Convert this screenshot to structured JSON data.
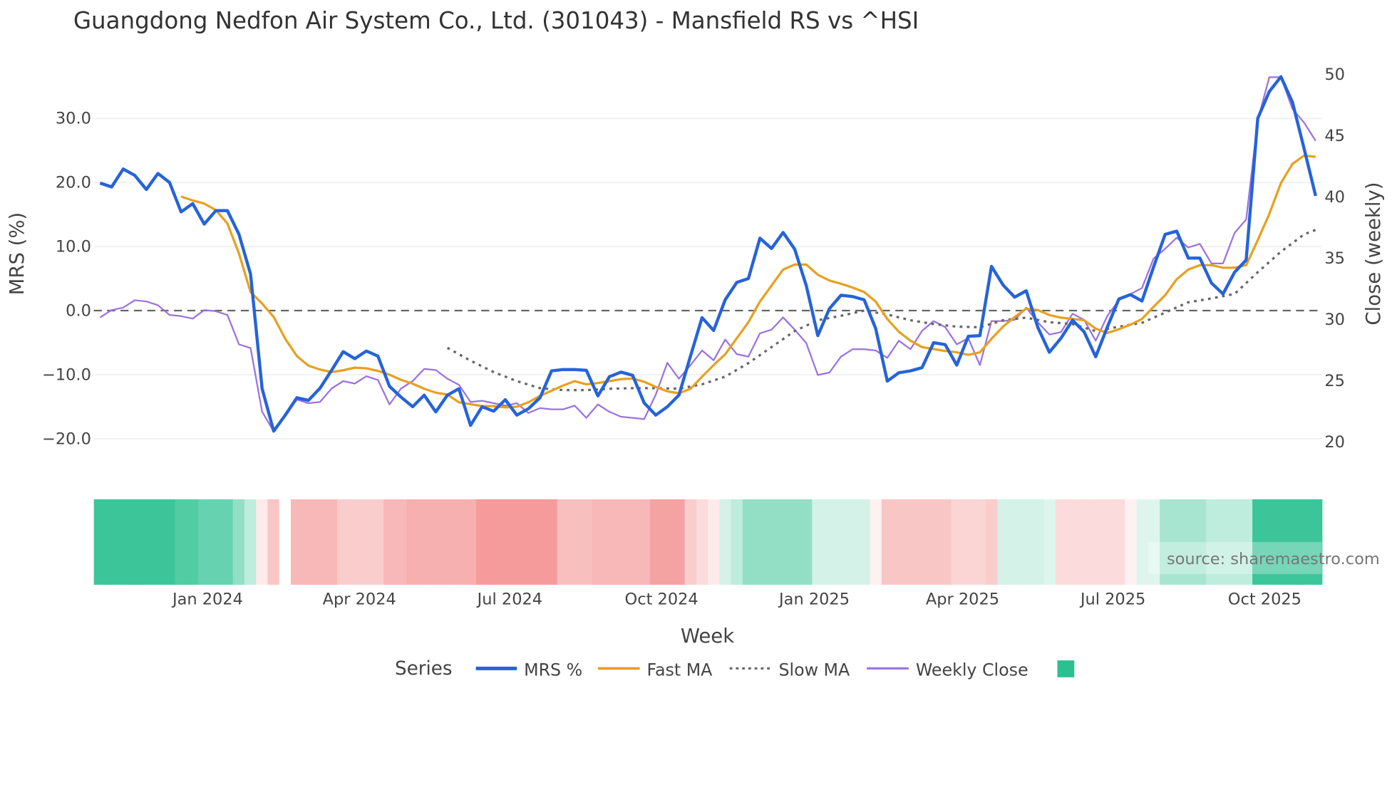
{
  "chart_data": {
    "type": "line",
    "title": "Guangdong Nedfon Air System Co., Ltd. (301043) - Mansfield RS vs ^HSI",
    "xlabel": "Week",
    "ylabel": "MRS (%)",
    "y2label": "Close (weekly)",
    "ylim": [
      -23,
      42
    ],
    "y2lim": [
      16,
      52
    ],
    "y_ticks": [
      "30.0",
      "20.0",
      "10.0",
      "0.0",
      "−10.0",
      "−20.0"
    ],
    "y_tick_values": [
      30,
      20,
      10,
      0,
      -10,
      -20
    ],
    "y2_ticks": [
      "50",
      "45",
      "40",
      "35",
      "30",
      "25",
      "20"
    ],
    "y2_tick_values": [
      50,
      45,
      40,
      35,
      30,
      25,
      20
    ],
    "x_ticks": [
      "Jan 2024",
      "Apr 2024",
      "Jul 2024",
      "Oct 2024",
      "Jan 2025",
      "Apr 2025",
      "Jul 2025",
      "Oct 2025"
    ],
    "x_tick_weeks": [
      9.3,
      22.4,
      35.4,
      48.5,
      61.7,
      74.5,
      87.5,
      100.6
    ],
    "zero_line": 0,
    "grid": true,
    "legend_title": "Series",
    "legend_position": "bottom",
    "source": "source: sharemaestro.com",
    "colors": {
      "mrs": "#2563d9",
      "fast": "#e8a020",
      "slow": "#666666",
      "close": "#9b72e0",
      "heat_pos": "#26bf8c",
      "heat_neg": "#f07070"
    },
    "series": [
      {
        "name": "MRS %",
        "key": "mrs",
        "axis": "left",
        "start_week": 0,
        "step": 1,
        "values": [
          19.9,
          19.3,
          22.1,
          21.1,
          18.9,
          21.4,
          20.0,
          15.4,
          16.7,
          13.5,
          15.6,
          15.6,
          11.9,
          5.7,
          -12.2,
          -18.8,
          -16.3,
          -13.6,
          -14.0,
          -12.1,
          -9.3,
          -6.4,
          -7.5,
          -6.3,
          -7.1,
          -11.8,
          -13.5,
          -15.0,
          -13.2,
          -15.8,
          -13.2,
          -12.2,
          -17.9,
          -15.0,
          -15.7,
          -13.9,
          -16.3,
          -15.3,
          -13.6,
          -9.4,
          -9.2,
          -9.2,
          -9.3,
          -13.3,
          -10.3,
          -9.6,
          -10.1,
          -14.4,
          -16.3,
          -15.0,
          -13.2,
          -7.1,
          -1.1,
          -3.1,
          1.7,
          4.4,
          5.0,
          11.3,
          9.7,
          12.2,
          9.6,
          3.9,
          -3.9,
          0.3,
          2.4,
          2.2,
          1.7,
          -2.8,
          -11.0,
          -9.7,
          -9.4,
          -8.9,
          -5.0,
          -5.3,
          -8.5,
          -4.0,
          -3.9,
          6.9,
          4.0,
          2.1,
          3.1,
          -2.6,
          -6.5,
          -4.3,
          -1.5,
          -3.3,
          -7.2,
          -2.6,
          1.8,
          2.5,
          1.5,
          6.8,
          11.9,
          12.4,
          8.2,
          8.2,
          4.3,
          2.6,
          6.0,
          7.9,
          30.0,
          34.2,
          36.5,
          32.5,
          25.3,
          17.9
        ]
      },
      {
        "name": "Fast MA",
        "key": "fast",
        "axis": "left",
        "start_week": 7,
        "step": 1,
        "values": [
          17.8,
          17.2,
          16.7,
          15.7,
          13.6,
          8.9,
          2.9,
          1.1,
          -1.0,
          -4.4,
          -7.1,
          -8.6,
          -9.2,
          -9.6,
          -9.3,
          -8.9,
          -9.0,
          -9.4,
          -10.0,
          -10.8,
          -11.4,
          -12.2,
          -12.8,
          -13.1,
          -14.3,
          -14.6,
          -14.9,
          -14.9,
          -15.1,
          -15.0,
          -14.3,
          -13.3,
          -12.5,
          -11.7,
          -11.0,
          -11.5,
          -11.3,
          -11.0,
          -10.7,
          -10.6,
          -11.1,
          -11.9,
          -12.6,
          -12.9,
          -12.2,
          -10.3,
          -8.5,
          -6.8,
          -4.3,
          -1.8,
          1.4,
          3.9,
          6.4,
          7.2,
          7.2,
          5.6,
          4.7,
          4.2,
          3.6,
          2.9,
          1.4,
          -1.3,
          -3.3,
          -4.7,
          -5.7,
          -6.0,
          -6.3,
          -6.5,
          -6.9,
          -6.5,
          -4.4,
          -2.5,
          -1.0,
          0.3,
          0.1,
          -0.7,
          -1.1,
          -1.3,
          -1.5,
          -2.8,
          -3.5,
          -2.9,
          -2.2,
          -1.3,
          0.6,
          2.4,
          4.9,
          6.4,
          7.1,
          7.1,
          6.7,
          6.7,
          7.1,
          11.0,
          15.1,
          19.9,
          22.9,
          24.2,
          24.0
        ]
      },
      {
        "name": "Slow MA",
        "key": "slow",
        "axis": "left",
        "start_week": 30,
        "step": 2,
        "values": [
          -5.8,
          -7.8,
          -9.6,
          -11.0,
          -12.1,
          -12.4,
          -12.4,
          -12.2,
          -12.1,
          -12.1,
          -12.2,
          -11.5,
          -10.3,
          -8.2,
          -5.7,
          -3.2,
          -1.5,
          -0.8,
          0.0,
          -0.6,
          -1.5,
          -2.1,
          -2.5,
          -2.6,
          -1.5,
          -1.1,
          -1.8,
          -2.1,
          -3.2,
          -2.5,
          -1.9,
          -0.3,
          1.3,
          1.9,
          2.6,
          6.0,
          9.2,
          11.9,
          12.6
        ]
      },
      {
        "name": "Weekly Close",
        "key": "close",
        "axis": "right",
        "start_week": 0,
        "step": 1,
        "values": [
          30.1,
          30.7,
          30.9,
          31.5,
          31.4,
          31.1,
          30.3,
          30.2,
          30.0,
          30.7,
          30.6,
          30.3,
          27.9,
          27.6,
          22.4,
          20.8,
          22.1,
          23.4,
          23.1,
          23.2,
          24.3,
          24.9,
          24.7,
          25.3,
          25.0,
          23.0,
          24.3,
          24.9,
          25.9,
          25.8,
          25.1,
          24.6,
          23.2,
          23.3,
          23.1,
          22.9,
          23.1,
          22.3,
          22.7,
          22.6,
          22.6,
          22.9,
          21.9,
          23.0,
          22.4,
          22.0,
          21.9,
          21.8,
          23.8,
          26.4,
          25.1,
          26.2,
          27.4,
          26.6,
          28.3,
          27.1,
          26.9,
          28.8,
          29.1,
          30.1,
          29.1,
          28.0,
          25.4,
          25.6,
          26.9,
          27.5,
          27.5,
          27.4,
          26.8,
          28.2,
          27.5,
          29.0,
          29.8,
          29.3,
          27.9,
          28.4,
          26.2,
          29.8,
          29.8,
          29.9,
          30.9,
          29.7,
          28.7,
          28.9,
          30.4,
          29.9,
          28.2,
          30.2,
          31.5,
          32.0,
          32.5,
          34.9,
          35.7,
          36.6,
          35.8,
          36.1,
          34.5,
          34.5,
          37.0,
          38.1,
          46.2,
          49.7,
          49.7,
          47.1,
          46.0,
          44.5
        ]
      }
    ],
    "heatmap": {
      "name": "",
      "values": [
        0.9,
        0.9,
        0.9,
        0.9,
        0.9,
        0.9,
        0.9,
        0.8,
        0.8,
        0.7,
        0.7,
        0.7,
        0.5,
        0.3,
        -0.15,
        -0.4,
        null,
        -0.5,
        -0.5,
        -0.5,
        -0.5,
        -0.35,
        -0.35,
        -0.35,
        -0.35,
        -0.5,
        -0.5,
        -0.55,
        -0.55,
        -0.55,
        -0.55,
        -0.55,
        -0.55,
        -0.7,
        -0.7,
        -0.7,
        -0.7,
        -0.7,
        -0.7,
        -0.7,
        -0.45,
        -0.45,
        -0.45,
        -0.5,
        -0.5,
        -0.5,
        -0.5,
        -0.5,
        -0.65,
        -0.65,
        -0.65,
        -0.35,
        -0.25,
        -0.15,
        0.2,
        0.3,
        0.5,
        0.5,
        0.5,
        0.5,
        0.5,
        0.5,
        0.2,
        0.2,
        0.2,
        0.2,
        0.2,
        -0.1,
        -0.4,
        -0.4,
        -0.4,
        -0.4,
        -0.4,
        -0.4,
        -0.3,
        -0.3,
        -0.3,
        -0.35,
        0.2,
        0.2,
        0.2,
        0.2,
        0.15,
        -0.25,
        -0.25,
        -0.25,
        -0.25,
        -0.25,
        -0.25,
        -0.1,
        0.15,
        0.15,
        0.4,
        0.4,
        0.4,
        0.4,
        0.3,
        0.3,
        0.3,
        0.3,
        0.9,
        0.9,
        0.9,
        0.9,
        0.9,
        0.9
      ]
    }
  }
}
